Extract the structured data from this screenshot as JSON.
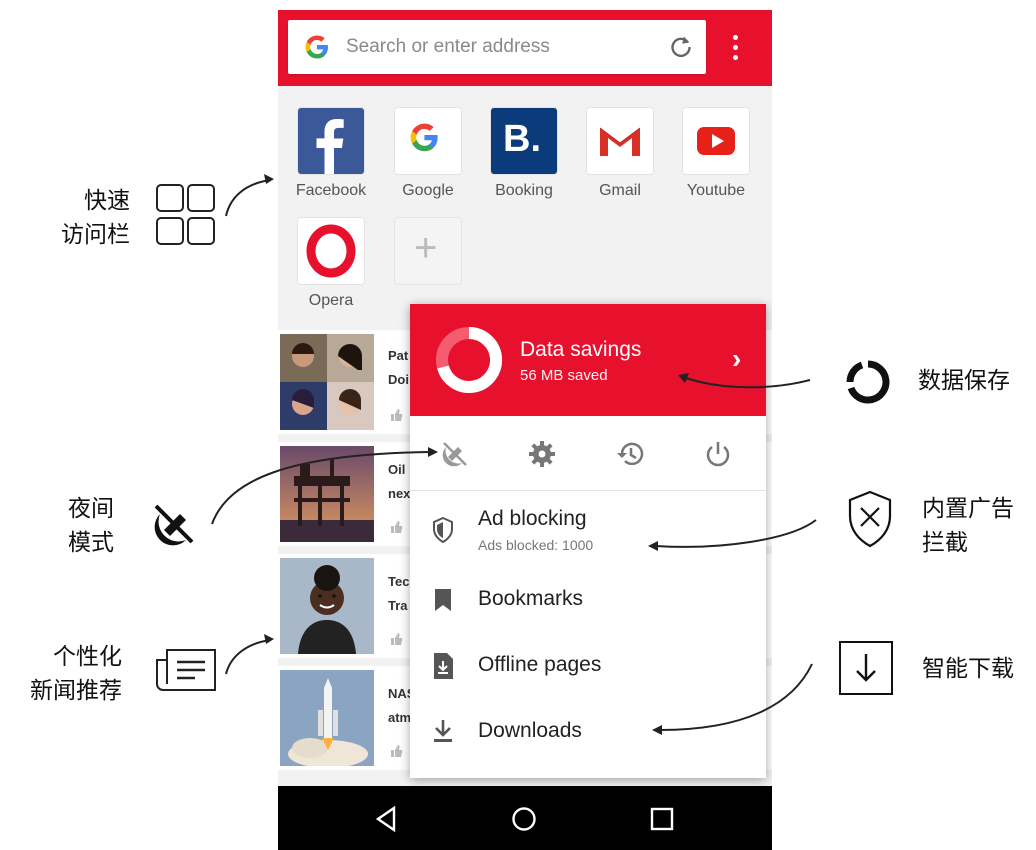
{
  "browser": {
    "search_placeholder": "Search or enter address",
    "search_logo": "G"
  },
  "speed_dial": {
    "tiles": [
      {
        "label": "Facebook",
        "icon": "facebook-logo",
        "glyph": "f"
      },
      {
        "label": "Google",
        "icon": "google-logo",
        "glyph": "G"
      },
      {
        "label": "Booking",
        "icon": "booking-logo",
        "glyph": "B."
      },
      {
        "label": "Gmail",
        "icon": "gmail-logo",
        "glyph": "M"
      },
      {
        "label": "Youtube",
        "icon": "youtube-logo",
        "glyph": ""
      },
      {
        "label": "Opera",
        "icon": "opera-logo",
        "glyph": "O"
      }
    ],
    "add_glyph": "+"
  },
  "news": [
    {
      "line1": "Pat",
      "line2": "Doi"
    },
    {
      "line1": "Oil",
      "line2": "nex"
    },
    {
      "line1": "Tec",
      "line2": "Tra"
    },
    {
      "line1": "NAS",
      "line2": "atm"
    }
  ],
  "menu": {
    "data_savings": {
      "title": "Data savings",
      "subtitle": "56 MB saved",
      "chevron": "›"
    },
    "icons": [
      "night-mode-icon",
      "settings-icon",
      "history-icon",
      "power-icon"
    ],
    "items": [
      {
        "label": "Ad blocking",
        "sub": "Ads blocked: 1000",
        "icon": "shield-icon"
      },
      {
        "label": "Bookmarks",
        "icon": "bookmark-icon"
      },
      {
        "label": "Offline pages",
        "icon": "offline-page-icon"
      },
      {
        "label": "Downloads",
        "icon": "download-icon"
      }
    ]
  },
  "annotations": {
    "speed_dial": [
      "快速",
      "访问栏"
    ],
    "night_mode": [
      "夜间",
      "模式"
    ],
    "news": [
      "个性化",
      "新闻推荐"
    ],
    "data_saving": "数据保存",
    "ad_block": [
      "内置广告",
      "拦截"
    ],
    "download": "智能下载"
  },
  "colors": {
    "accent": "#e8112d",
    "facebook": "#3b5998",
    "booking": "#0c3b7c",
    "youtube": "#e62117"
  }
}
